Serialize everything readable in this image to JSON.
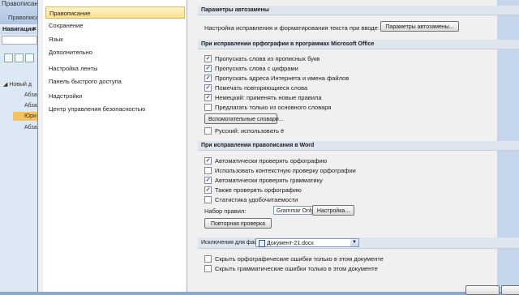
{
  "background": {
    "ribbon_text": "Правописани",
    "ribbon_tab": "Правописание",
    "nav": {
      "title": "Навигация",
      "close": "×",
      "items": [
        "Новый д",
        "Абза",
        "Абза",
        "Юри",
        "Абза"
      ]
    }
  },
  "dialog": {
    "sidebar": [
      {
        "label": "Правописание",
        "selected": true
      },
      {
        "label": "Сохранение"
      },
      {
        "label": "Язык"
      },
      {
        "label": "Дополнительно"
      },
      {
        "label": "Настройка ленты"
      },
      {
        "label": "Панель быстрого доступа"
      },
      {
        "label": "Надстройки"
      },
      {
        "label": "Центр управления безопасностью"
      }
    ],
    "autocorrect": {
      "header": "Параметры автозамены",
      "text": "Настройка исправления и форматирования текста при вводе:",
      "button": "Параметры автозамены..."
    },
    "office_spelling": {
      "header": "При исправлении орфографии в программах Microsoft Office",
      "options": [
        {
          "label": "Пропускать слова из прописных букв",
          "checked": true
        },
        {
          "label": "Пропускать слова с цифрами",
          "checked": true
        },
        {
          "label": "Пропускать адреса Интернета и имена файлов",
          "checked": true
        },
        {
          "label": "Помечать повторяющиеся слова",
          "checked": true
        },
        {
          "label": "Немецкий: применять новые правила",
          "checked": true
        },
        {
          "label": "Предлагать только из основного словаря",
          "checked": false
        }
      ],
      "dict_button": "Вспомогательные словари...",
      "russian_option": {
        "label": "Русский: использовать ё",
        "checked": false
      }
    },
    "word_spelling": {
      "header": "При исправлении правописания в Word",
      "options": [
        {
          "label": "Автоматически проверять орфографию",
          "checked": true
        },
        {
          "label": "Использовать контекстную проверку орфографии",
          "checked": false
        },
        {
          "label": "Автоматически проверять грамматику",
          "checked": true
        },
        {
          "label": "Также проверять орфографию",
          "checked": true
        },
        {
          "label": "Статистика удобочитаемости",
          "checked": false
        }
      ],
      "rules_label": "Набор правил:",
      "rules_value": "Grammar Only",
      "settings_button": "Настройка...",
      "recheck_button": "Повторная проверка"
    },
    "exceptions": {
      "label": "Исключения для файла:",
      "file": "Документ-21.docx",
      "options": [
        {
          "label": "Скрыть орфографические ошибки только в этом документе",
          "checked": false
        },
        {
          "label": "Скрыть грамматические ошибки только в этом документе",
          "checked": false
        }
      ]
    },
    "check_mark": "✓",
    "dropdown_arrow": "▼"
  }
}
